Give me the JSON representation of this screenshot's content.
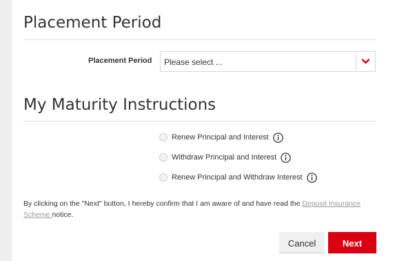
{
  "placement": {
    "section_title": "Placement Period",
    "field_label": "Placement Period",
    "select_value": "Please select ..."
  },
  "maturity": {
    "section_title": "My Maturity Instructions",
    "options": [
      {
        "label": "Renew Principal and Interest",
        "selected": false
      },
      {
        "label": "Withdraw Principal and Interest",
        "selected": false
      },
      {
        "label": "Renew Principal and Withdraw Interest",
        "selected": false
      }
    ]
  },
  "disclaimer": {
    "before_link": "By clicking on the \"Next\" button, I hereby confirm that I am aware of and have read the ",
    "link_text": "Deposit Insurance Scheme ",
    "after_link": "notice."
  },
  "actions": {
    "cancel_label": "Cancel",
    "next_label": "Next"
  },
  "colors": {
    "accent": "#db0011",
    "caret": "#db0011",
    "link": "#9a9a9a",
    "cancel_bg": "#f0f0f0"
  },
  "icons": {
    "dropdown": "chevron-down-icon",
    "info": "info-icon"
  }
}
